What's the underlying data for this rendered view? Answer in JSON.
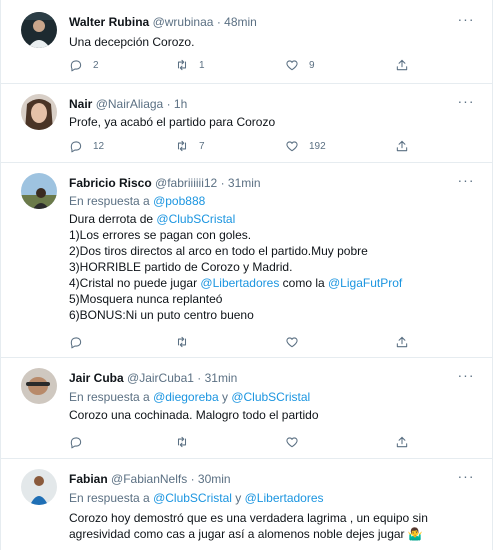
{
  "tweets": [
    {
      "name": "Walter Rubina",
      "handle": "@wrubinaa",
      "dot": "·",
      "time": "48min",
      "lines": [
        "Una decepción Corozo."
      ],
      "replies": "2",
      "retweets": "1",
      "likes": "9"
    },
    {
      "name": "Nair",
      "handle": "@NairAliaga",
      "dot": "·",
      "time": "1h",
      "lines": [
        "Profe, ya acabó el partido para Corozo"
      ],
      "replies": "12",
      "retweets": "7",
      "likes": "192"
    },
    {
      "name": "Fabricio Risco",
      "handle": "@fabriiiiii12",
      "dot": "·",
      "time": "31min",
      "reply_prefix": "En respuesta a",
      "reply_mention": "@pob888",
      "line1_pre": "Dura derrota de ",
      "line1_mention": "@ClubSCristal",
      "line2": "1)Los errores se pagan con goles.",
      "line3": "2)Dos tiros directos al arco en todo el partido.Muy pobre",
      "line4": "3)HORRIBLE partido de Corozo y Madrid.",
      "line5_pre": "4)Cristal no puede jugar ",
      "line5_mention1": "@Libertadores",
      "line5_mid": " como la ",
      "line5_mention2": "@LigaFutProf",
      "line6": "5)Mosquera nunca replanteó",
      "line7": "6)BONUS:Ni un puto centro bueno",
      "replies": "",
      "retweets": "",
      "likes": ""
    },
    {
      "name": "Jair Cuba",
      "handle": "@JairCuba1",
      "dot": "·",
      "time": "31min",
      "reply_prefix": "En respuesta a",
      "reply_mention1": "@diegoreba",
      "reply_and": "y",
      "reply_mention2": "@ClubSCristal",
      "lines": [
        "Corozo una cochinada. Malogro todo el partido"
      ],
      "replies": "",
      "retweets": "",
      "likes": ""
    },
    {
      "name": "Fabian",
      "handle": "@FabianNelfs",
      "dot": "·",
      "time": "30min",
      "reply_prefix": "En respuesta a",
      "reply_mention1": "@ClubSCristal",
      "reply_and": "y",
      "reply_mention2": "@Libertadores",
      "lines": [
        "Corozo hoy demostró que es una verdadera lagrima , un equipo sin",
        "agresividad como cas a jugar así a alomenos noble dejes jugar"
      ],
      "emoji": "🤷‍♂️"
    }
  ],
  "icons": {
    "reply": "reply-icon",
    "retweet": "retweet-icon",
    "like": "heart-icon",
    "share": "share-icon",
    "more": "more-options-icon"
  },
  "colors": {
    "link": "#1b95e0",
    "secondary": "#5b7083",
    "text": "#0f1419",
    "border": "#e6ecf0"
  }
}
